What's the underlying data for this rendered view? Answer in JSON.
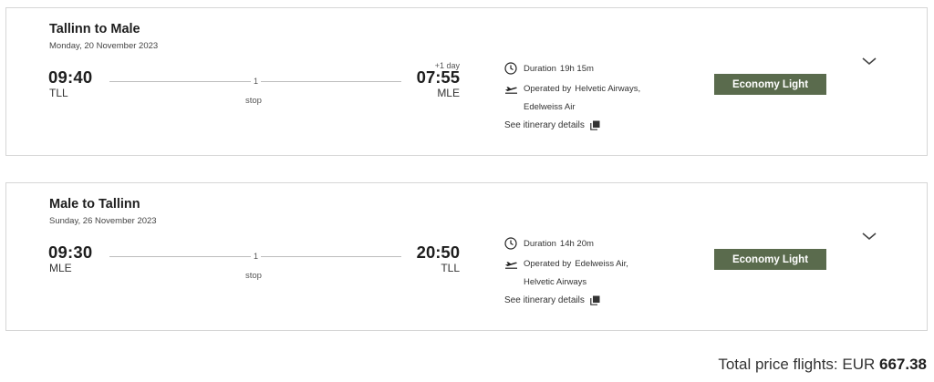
{
  "flights": [
    {
      "title": "Tallinn to Male",
      "date": "Monday, 20 November 2023",
      "departure_time": "09:40",
      "departure_code": "TLL",
      "stops_count": "1",
      "stops_label": "stop",
      "day_offset": "+1 day",
      "arrival_time": "07:55",
      "arrival_code": "MLE",
      "duration_label": "Duration",
      "duration_value": "19h 15m",
      "operated_label": "Operated by",
      "operated_line1": "Helvetic Airways,",
      "operated_line2": "Edelweiss Air",
      "details_link": "See itinerary details",
      "fare": "Economy Light"
    },
    {
      "title": "Male to Tallinn",
      "date": "Sunday, 26 November 2023",
      "departure_time": "09:30",
      "departure_code": "MLE",
      "stops_count": "1",
      "stops_label": "stop",
      "day_offset": "",
      "arrival_time": "20:50",
      "arrival_code": "TLL",
      "duration_label": "Duration",
      "duration_value": "14h 20m",
      "operated_label": "Operated by",
      "operated_line1": "Edelweiss Air,",
      "operated_line2": "Helvetic Airways",
      "details_link": "See itinerary details",
      "fare": "Economy Light"
    }
  ],
  "total": {
    "label": "Total price flights: EUR",
    "amount": "667.38"
  },
  "colors": {
    "fare_button": "#5a6b4d",
    "border": "#d6d6d6"
  },
  "icons": [
    "clock-icon",
    "plane-takeoff-icon",
    "external-link-icon",
    "chevron-down-icon"
  ]
}
